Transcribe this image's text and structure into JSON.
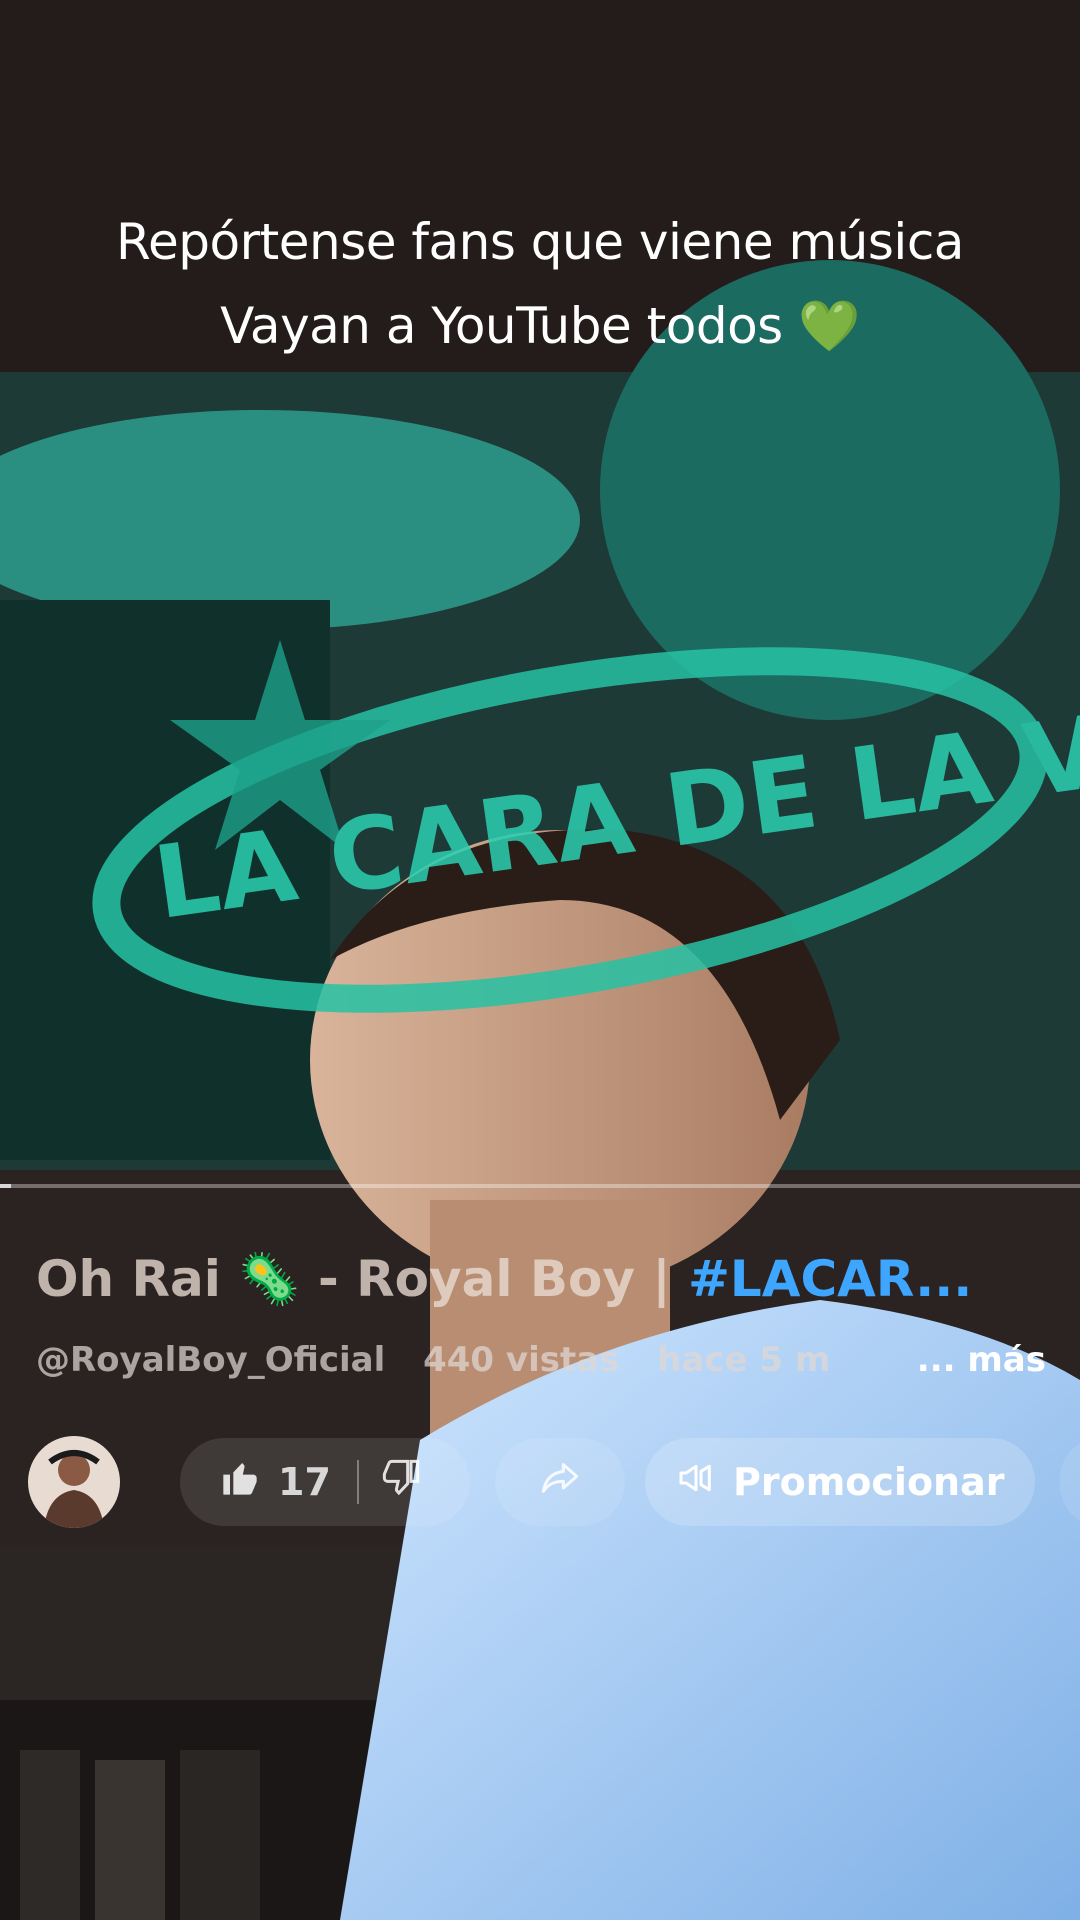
{
  "caption": {
    "line1": "Repórtense fans que viene música",
    "line2": "Vayan a YouTube todos",
    "emoji": "💚"
  },
  "video": {
    "title_prefix": "Oh Rai",
    "title_emoji": "🦠",
    "title_middle": " - Royal Boy | ",
    "title_hashtag": "#LACAR...",
    "channel": "@RoyalBoy_Oficial",
    "views": "440 vistas",
    "age": "hace 5 m",
    "more": "... más",
    "likes": "17",
    "promote_label": "Promocionar",
    "progress_percent": 1
  },
  "overlay_text": "LA CARA DE LA V",
  "icons": {
    "like": "thumbs-up-icon",
    "dislike": "thumbs-down-icon",
    "share": "share-icon",
    "promote": "megaphone-icon"
  },
  "colors": {
    "teal": "#1fb39a",
    "hashtag": "#3ea6ff",
    "heart": "#5fd35a"
  }
}
